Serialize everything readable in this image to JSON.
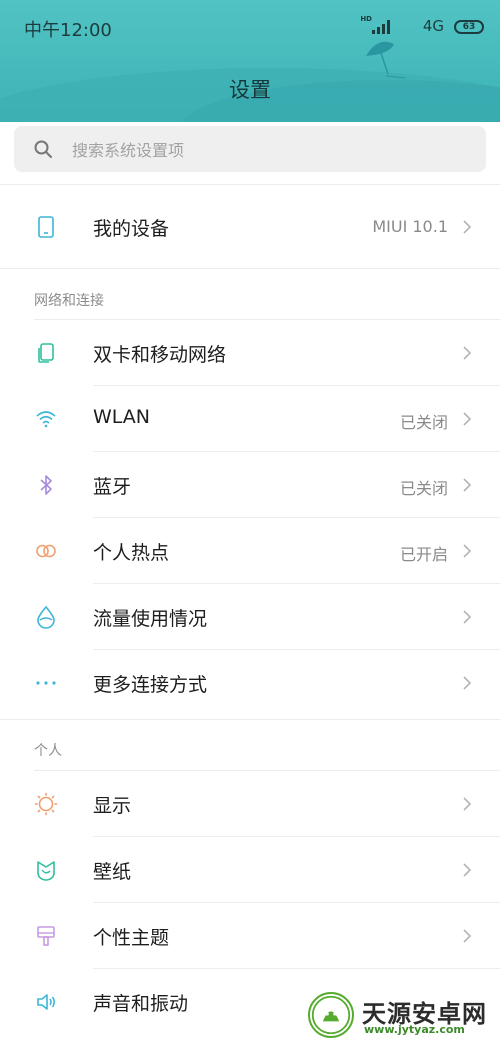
{
  "status": {
    "time": "中午12:00",
    "hd": "HD",
    "network": "4G",
    "battery": "63"
  },
  "header": {
    "title": "设置"
  },
  "search": {
    "placeholder": "搜索系统设置项"
  },
  "device": {
    "label": "我的设备",
    "value": "MIUI 10.1"
  },
  "sections": {
    "network": "网络和连接",
    "personal": "个人"
  },
  "network_items": [
    {
      "label": "双卡和移动网络",
      "value": "",
      "icon": "dual-sim-icon"
    },
    {
      "label": "WLAN",
      "value": "已关闭",
      "icon": "wifi-icon"
    },
    {
      "label": "蓝牙",
      "value": "已关闭",
      "icon": "bluetooth-icon"
    },
    {
      "label": "个人热点",
      "value": "已开启",
      "icon": "hotspot-icon"
    },
    {
      "label": "流量使用情况",
      "value": "",
      "icon": "data-usage-icon"
    },
    {
      "label": "更多连接方式",
      "value": "",
      "icon": "more-connections-icon"
    }
  ],
  "personal_items": [
    {
      "label": "显示",
      "icon": "display-icon"
    },
    {
      "label": "壁纸",
      "icon": "wallpaper-icon"
    },
    {
      "label": "个性主题",
      "icon": "theme-icon"
    },
    {
      "label": "声音和振动",
      "icon": "sound-icon"
    }
  ],
  "watermark": {
    "title": "天源安卓网",
    "url": "www.jytyaz.com"
  },
  "colors": {
    "header": "#44b9bb",
    "wifi": "#3db6d8",
    "bluetooth": "#a78be0",
    "hotspot": "#f0a070",
    "display": "#f0a070",
    "theme": "#c79be4"
  }
}
